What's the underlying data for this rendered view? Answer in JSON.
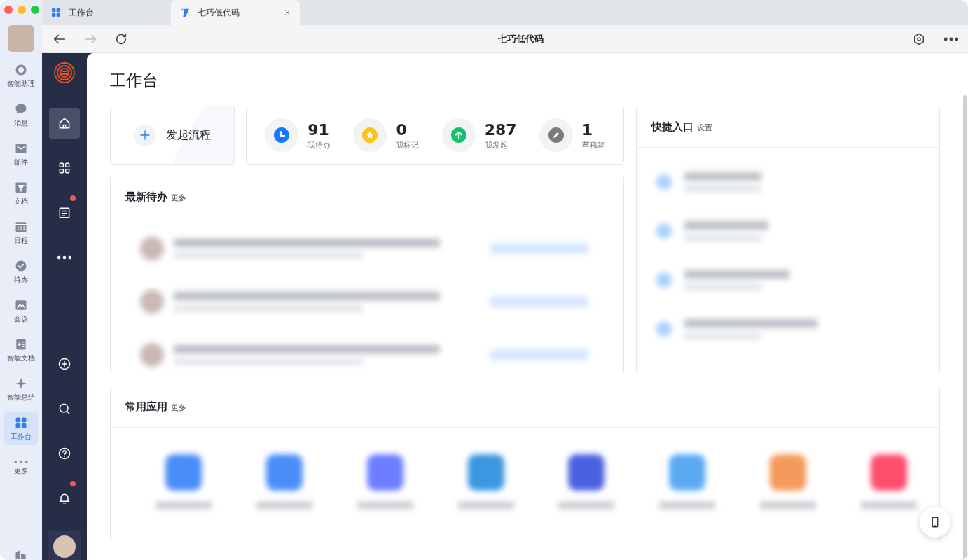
{
  "tabs": [
    {
      "label": "工作台",
      "selected": false,
      "kind": "grid"
    },
    {
      "label": "七巧低代码",
      "selected": true,
      "kind": "app"
    }
  ],
  "toolbar": {
    "title": "七巧低代码"
  },
  "rail": {
    "items": [
      {
        "label": "智能助理",
        "selected": false,
        "kind": "ring"
      },
      {
        "label": "消息",
        "selected": false,
        "kind": "bubble"
      },
      {
        "label": "邮件",
        "selected": false,
        "kind": "mail"
      },
      {
        "label": "文档",
        "selected": false,
        "kind": "doc"
      },
      {
        "label": "日程",
        "selected": false,
        "kind": "calendar"
      },
      {
        "label": "待办",
        "selected": false,
        "kind": "check"
      },
      {
        "label": "会议",
        "selected": false,
        "kind": "meeting"
      },
      {
        "label": "智能文档",
        "selected": false,
        "kind": "smartdoc"
      },
      {
        "label": "智能总结",
        "selected": false,
        "kind": "sparkle"
      },
      {
        "label": "工作台",
        "selected": true,
        "kind": "grid"
      },
      {
        "label": "更多",
        "selected": false,
        "kind": "dots"
      }
    ]
  },
  "sidebar": {
    "top": [
      {
        "kind": "home",
        "selected": true,
        "badge": false
      },
      {
        "kind": "apps",
        "selected": false,
        "badge": false
      },
      {
        "kind": "list",
        "selected": false,
        "badge": true
      },
      {
        "kind": "dots",
        "selected": false,
        "badge": false
      }
    ],
    "bottom": [
      {
        "kind": "plus",
        "selected": false,
        "badge": false
      },
      {
        "kind": "search",
        "selected": false,
        "badge": false
      },
      {
        "kind": "help",
        "selected": false,
        "badge": false
      },
      {
        "kind": "bell",
        "selected": false,
        "badge": true
      }
    ]
  },
  "page": {
    "title": "工作台",
    "start_button": {
      "label": "发起流程"
    },
    "stats": [
      {
        "kind": "clock",
        "value": "91",
        "label": "我待办"
      },
      {
        "kind": "star",
        "value": "0",
        "label": "我标记"
      },
      {
        "kind": "up",
        "value": "287",
        "label": "我发起"
      },
      {
        "kind": "pen",
        "value": "1",
        "label": "草稿箱"
      }
    ],
    "todo": {
      "title": "最新待办",
      "more": "更多"
    },
    "quick": {
      "title": "快捷入口",
      "settings": "设置"
    },
    "apps": {
      "title": "常用应用",
      "more": "更多"
    }
  }
}
